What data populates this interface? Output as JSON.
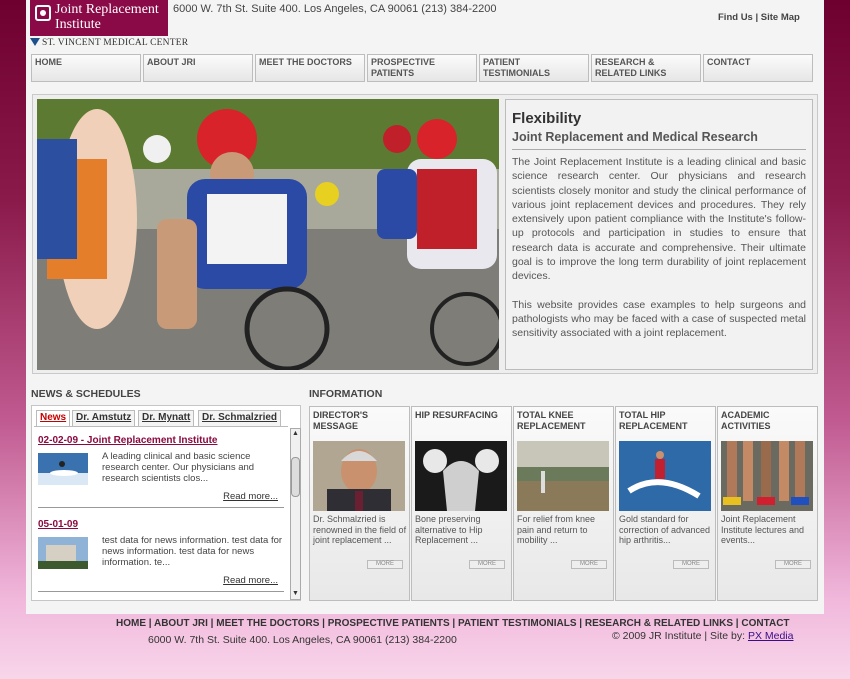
{
  "header": {
    "logo_text": "Joint Replacement Institute",
    "logo_sub": "ST. VINCENT MEDICAL CENTER",
    "address": "6000 W. 7th St. Suite 400. Los Angeles, CA 90061 (213) 384-2200",
    "find_us": "Find Us",
    "site_map": "Site Map",
    "sep": " | "
  },
  "nav": [
    {
      "label": "HOME"
    },
    {
      "label": "ABOUT JRI"
    },
    {
      "label": "MEET THE DOCTORS"
    },
    {
      "label": "PROSPECTIVE PATIENTS"
    },
    {
      "label": "PATIENT TESTIMONIALS"
    },
    {
      "label": "RESEARCH & RELATED LINKS"
    },
    {
      "label": "CONTACT"
    }
  ],
  "feature": {
    "title": "Flexibility",
    "subtitle": "Joint Replacement and Medical Research",
    "p1": "The Joint Replacement Institute is a leading clinical and basic science research center. Our physicians and research scientists closely monitor and study the clinical performance of various joint replacement devices and procedures. They rely extensively upon patient compliance with the Institute's follow-up protocols and participation in studies to ensure that research data is accurate and comprehensive. Their ultimate goal is to improve the long term durability of joint replacement devices.",
    "p2": "This website provides case examples to help surgeons and pathologists who may be faced with a case of suspected metal sensitivity associated with a joint replacement."
  },
  "news": {
    "heading": "NEWS & SCHEDULES",
    "tabs": [
      {
        "label": "News"
      },
      {
        "label": "Dr. Amstutz"
      },
      {
        "label": "Dr. Mynatt"
      },
      {
        "label": "Dr. Schmalzried"
      }
    ],
    "items": [
      {
        "title": "02-02-09 - Joint Replacement Institute",
        "text": "A leading clinical and basic science research center. Our physicians and research scientists clos...",
        "more": "Read more..."
      },
      {
        "title": "05-01-09",
        "text": "test data for news information.  test data for news information. test data for news information. te...",
        "more": "Read more..."
      }
    ]
  },
  "info": {
    "heading": "INFORMATION",
    "cards": [
      {
        "title": "DIRECTOR'S MESSAGE",
        "text": "Dr. Schmalzried is renowned in the field of joint replacement ...",
        "more": "MORE"
      },
      {
        "title": "HIP RESURFACING",
        "text": "Bone preserving alternative to Hip Replacement  ...",
        "more": "MORE"
      },
      {
        "title": "TOTAL KNEE REPLACEMENT",
        "text": "For relief from knee pain and return to mobility   ...",
        "more": "MORE"
      },
      {
        "title": "TOTAL HIP REPLACEMENT",
        "text": "Gold standard for correction of advanced hip arthritis...",
        "more": "MORE"
      },
      {
        "title": "ACADEMIC ACTIVITIES",
        "text": "Joint Replacement Institute lectures and events...",
        "more": "MORE"
      }
    ]
  },
  "footer": {
    "links": [
      {
        "label": "HOME"
      },
      {
        "label": "ABOUT JRI"
      },
      {
        "label": "MEET THE DOCTORS"
      },
      {
        "label": "PROSPECTIVE PATIENTS"
      },
      {
        "label": "PATIENT TESTIMONIALS"
      },
      {
        "label": "RESEARCH & RELATED LINKS"
      },
      {
        "label": "CONTACT"
      }
    ],
    "address": "6000 W. 7th St. Suite 400. Los Angeles, CA 90061 (213) 384-2200",
    "copyright": "© 2009 JR Institute | Site by: ",
    "site_by": "PX Media"
  },
  "colors": {
    "brand": "#8a0a48",
    "accent_red": "#c40000",
    "link_purple": "#3a0c8a"
  }
}
